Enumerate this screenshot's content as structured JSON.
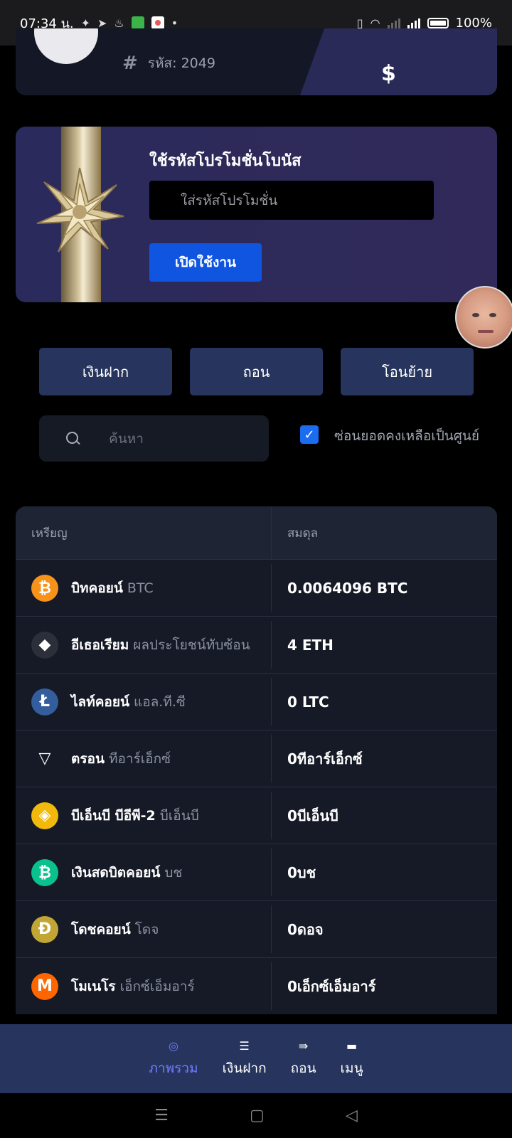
{
  "status_bar": {
    "time": "07:34 น.",
    "battery": "100%"
  },
  "profile": {
    "code_label": "รหัส: 2049",
    "currency_symbol": "$"
  },
  "promo": {
    "title": "ใช้รหัสโปรโมชั่นโบนัส",
    "input_placeholder": "ใส่รหัสโปรโมชั่น",
    "activate_label": "เปิดใช้งาน"
  },
  "actions": {
    "deposit": "เงินฝาก",
    "withdraw": "ถอน",
    "transfer": "โอนย้าย"
  },
  "search": {
    "placeholder": "ค้นหา"
  },
  "hide_zero": {
    "label": "ซ่อนยอดคงเหลือเป็นศูนย์",
    "checked": true
  },
  "table": {
    "headers": [
      "เหรียญ",
      "สมดุล"
    ],
    "rows": [
      {
        "name": "บิทคอยน์",
        "sub": "BTC",
        "balance": "0.0064096 BTC",
        "icon": "bitcoin-icon",
        "color": "#f7931a",
        "glyph": "₿"
      },
      {
        "name": "อีเธอเรียม",
        "sub": "ผลประโยชน์ทับซ้อน",
        "balance": "4 ETH",
        "icon": "ethereum-icon",
        "color": "#2a2f3a",
        "glyph": "◆"
      },
      {
        "name": "ไลท์คอยน์",
        "sub": "แอล.ที.ซี",
        "balance": "0 LTC",
        "icon": "litecoin-icon",
        "color": "#345d9d",
        "glyph": "Ł"
      },
      {
        "name": "ตรอน",
        "sub": "ทีอาร์เอ็กซ์",
        "balance": "0ทีอาร์เอ็กซ์",
        "icon": "tron-icon",
        "color": "#151a26",
        "glyph": "▽"
      },
      {
        "name": "บีเอ็นบี บีอีพี-2",
        "sub": "บีเอ็นบี",
        "balance": "0บีเอ็นบี",
        "icon": "bnb-icon",
        "color": "#f0b90b",
        "glyph": "◈"
      },
      {
        "name": "เงินสดบิตคอยน์",
        "sub": "บช",
        "balance": "0บช",
        "icon": "bitcoin-cash-icon",
        "color": "#0ac18e",
        "glyph": "₿"
      },
      {
        "name": "โดชคอยน์",
        "sub": "โดจ",
        "balance": "0ดอจ",
        "icon": "dogecoin-icon",
        "color": "#c2a633",
        "glyph": "Ð"
      },
      {
        "name": "โมเนโร",
        "sub": "เอ็กซ์เอ็มอาร์",
        "balance": "0เอ็กซ์เอ็มอาร์",
        "icon": "monero-icon",
        "color": "#ff6600",
        "glyph": "M"
      }
    ]
  },
  "bottom_nav": [
    {
      "label": "ภาพรวม",
      "icon": "target-icon",
      "active": true
    },
    {
      "label": "เงินฝาก",
      "icon": "coins-icon",
      "active": false
    },
    {
      "label": "ถอน",
      "icon": "arrow-right-icon",
      "active": false
    },
    {
      "label": "เมนู",
      "icon": "chat-icon",
      "active": false
    }
  ]
}
